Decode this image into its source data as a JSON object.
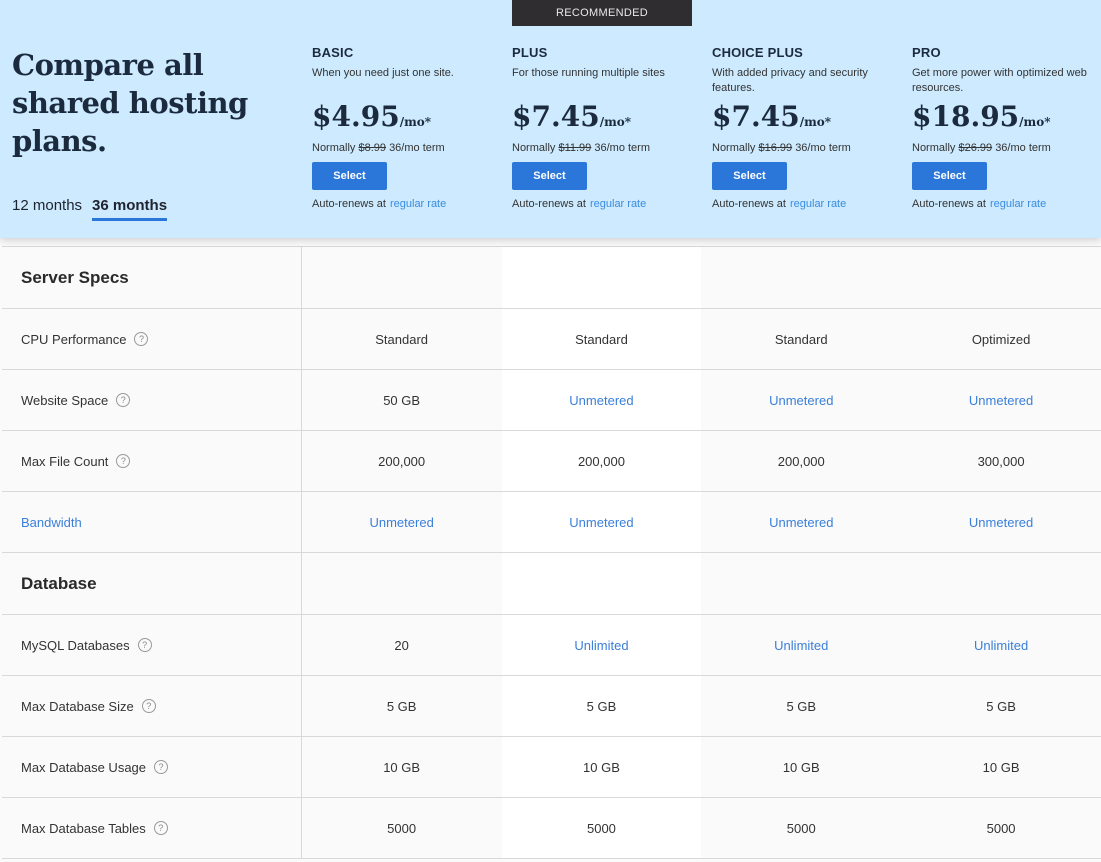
{
  "header": {
    "title": "Compare all shared hosting plans.",
    "terms": [
      {
        "label": "12 months",
        "active": false
      },
      {
        "label": "36 months",
        "active": true
      }
    ],
    "recommended_badge": "RECOMMENDED"
  },
  "plans": [
    {
      "name": "BASIC",
      "desc": "When you need just one site.",
      "price": "$4.95",
      "per": "/mo*",
      "normally_prefix": "Normally",
      "normal_price": "$8.99",
      "term": "36/mo term",
      "select_label": "Select",
      "autorenew_text": "Auto-renews at",
      "autorenew_link": "regular rate"
    },
    {
      "name": "PLUS",
      "desc": "For those running multiple sites",
      "price": "$7.45",
      "per": "/mo*",
      "normally_prefix": "Normally",
      "normal_price": "$11.99",
      "term": "36/mo term",
      "select_label": "Select",
      "autorenew_text": "Auto-renews at",
      "autorenew_link": "regular rate"
    },
    {
      "name": "CHOICE PLUS",
      "desc": "With added privacy and security features.",
      "price": "$7.45",
      "per": "/mo*",
      "normally_prefix": "Normally",
      "normal_price": "$16.99",
      "term": "36/mo term",
      "select_label": "Select",
      "autorenew_text": "Auto-renews at",
      "autorenew_link": "regular rate"
    },
    {
      "name": "PRO",
      "desc": "Get more power with optimized web resources.",
      "price": "$18.95",
      "per": "/mo*",
      "normally_prefix": "Normally",
      "normal_price": "$26.99",
      "term": "36/mo term",
      "select_label": "Select",
      "autorenew_text": "Auto-renews at",
      "autorenew_link": "regular rate"
    }
  ],
  "help_glyph": "?",
  "rows": [
    {
      "type": "section",
      "label": "Server Specs"
    },
    {
      "type": "feature",
      "label": "CPU Performance",
      "help": true,
      "values": [
        "Standard",
        "Standard",
        "Standard",
        "Optimized"
      ],
      "links": [
        false,
        false,
        false,
        false
      ]
    },
    {
      "type": "feature",
      "label": "Website Space",
      "help": true,
      "values": [
        "50 GB",
        "Unmetered",
        "Unmetered",
        "Unmetered"
      ],
      "links": [
        false,
        true,
        true,
        true
      ]
    },
    {
      "type": "feature",
      "label": "Max File Count",
      "help": true,
      "values": [
        "200,000",
        "200,000",
        "200,000",
        "300,000"
      ],
      "links": [
        false,
        false,
        false,
        false
      ]
    },
    {
      "type": "feature",
      "label": "Bandwidth",
      "help": false,
      "label_link": true,
      "values": [
        "Unmetered",
        "Unmetered",
        "Unmetered",
        "Unmetered"
      ],
      "links": [
        true,
        true,
        true,
        true
      ]
    },
    {
      "type": "section",
      "label": "Database"
    },
    {
      "type": "feature",
      "label": "MySQL Databases",
      "help": true,
      "values": [
        "20",
        "Unlimited",
        "Unlimited",
        "Unlimited"
      ],
      "links": [
        false,
        true,
        true,
        true
      ]
    },
    {
      "type": "feature",
      "label": "Max Database Size",
      "help": true,
      "values": [
        "5 GB",
        "5 GB",
        "5 GB",
        "5 GB"
      ],
      "links": [
        false,
        false,
        false,
        false
      ]
    },
    {
      "type": "feature",
      "label": "Max Database Usage",
      "help": true,
      "values": [
        "10 GB",
        "10 GB",
        "10 GB",
        "10 GB"
      ],
      "links": [
        false,
        false,
        false,
        false
      ]
    },
    {
      "type": "feature",
      "label": "Max Database Tables",
      "help": true,
      "values": [
        "5000",
        "5000",
        "5000",
        "5000"
      ],
      "links": [
        false,
        false,
        false,
        false
      ]
    }
  ]
}
